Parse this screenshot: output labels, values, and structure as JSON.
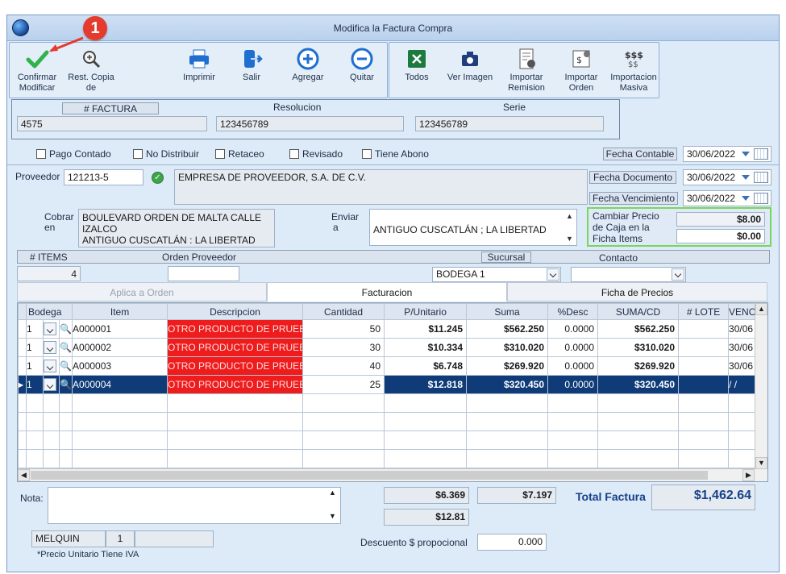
{
  "window": {
    "title": "Modifica la Factura Compra"
  },
  "annotation": {
    "badge": "1"
  },
  "toolbar": {
    "confirm": "Confirmar Modificar",
    "confirm_l1": "Confirmar",
    "confirm_l2": "Modificar",
    "rest_l1": "Rest. Copia",
    "rest_l2": "de",
    "print": "Imprimir",
    "exit": "Salir",
    "add": "Agregar",
    "remove": "Quitar",
    "all": "Todos",
    "view_image": "Ver Imagen",
    "import_remision_l1": "Importar",
    "import_remision_l2": "Remision",
    "import_orden_l1": "Importar",
    "import_orden_l2": "Orden",
    "import_masiva_l1": "Importacion",
    "import_masiva_l2": "Masiva"
  },
  "header": {
    "factura_label": "# FACTURA",
    "factura": "4575",
    "resolucion_label": "Resolucion",
    "resolucion": "123456789",
    "serie_label": "Serie",
    "serie": "123456789"
  },
  "checkboxes": {
    "pago_contado": "Pago Contado",
    "no_distribuir": "No Distribuir",
    "retaceo": "Retaceo",
    "revisado": "Revisado",
    "tiene_abono": "Tiene Abono"
  },
  "dates": {
    "contable_label": "Fecha Contable",
    "contable": "30/06/2022",
    "documento_label": "Fecha Documento",
    "documento": "30/06/2022",
    "vencimiento_label": "Fecha Vencimiento",
    "vencimiento": "30/06/2022"
  },
  "proveedor": {
    "label": "Proveedor",
    "code": "121213-5",
    "name": "EMPRESA DE PROVEEDOR, S.A. DE C.V."
  },
  "cobrar": {
    "label1": "Cobrar",
    "label2": "en",
    "line1": "BOULEVARD ORDEN DE MALTA CALLE",
    "line2": "IZALCO",
    "line3": "ANTIGUO CUSCATLÁN : LA LIBERTAD"
  },
  "enviar": {
    "label1": "Enviar",
    "label2": "a",
    "value": "ANTIGUO CUSCATLÁN ; LA LIBERTAD"
  },
  "precio_caja": {
    "l1": "Cambiar Precio",
    "l2": "de Caja en la",
    "l3": "Ficha Items",
    "v1": "$8.00",
    "v2": "$0.00"
  },
  "info_row": {
    "items_label": "# ITEMS",
    "items": "4",
    "orden_label": "Orden Proveedor",
    "orden": "",
    "sucursal_label": "Sucursal",
    "sucursal": "BODEGA 1",
    "contacto_label": "Contacto",
    "contacto": ""
  },
  "tabs": [
    {
      "label": "Aplica a Orden"
    },
    {
      "label": "Facturacion"
    },
    {
      "label": "Ficha de Precios"
    }
  ],
  "grid": {
    "columns": [
      "Bodega",
      "Item",
      "Descripcion",
      "Cantidad",
      "P/Unitario",
      "Suma",
      "%Desc",
      "SUMA/CD",
      "# LOTE",
      "VENC"
    ],
    "rows": [
      {
        "bodega": "1",
        "item": "A000001",
        "descripcion": "OTRO PRODUCTO DE PRUEBA",
        "cantidad": "50",
        "unitario": "$11.245",
        "suma": "$562.250",
        "desc": "0.0000",
        "sumacd": "$562.250",
        "lote": "",
        "venc": "30/06"
      },
      {
        "bodega": "1",
        "item": "A000002",
        "descripcion": "OTRO PRODUCTO DE PRUEBA",
        "cantidad": "30",
        "unitario": "$10.334",
        "suma": "$310.020",
        "desc": "0.0000",
        "sumacd": "$310.020",
        "lote": "",
        "venc": "30/06"
      },
      {
        "bodega": "1",
        "item": "A000003",
        "descripcion": "OTRO PRODUCTO DE PRUEBA",
        "cantidad": "40",
        "unitario": "$6.748",
        "suma": "$269.920",
        "desc": "0.0000",
        "sumacd": "$269.920",
        "lote": "",
        "venc": "30/06"
      },
      {
        "bodega": "1",
        "item": "A000004",
        "descripcion": "OTRO PRODUCTO DE PRUEBA",
        "cantidad": "25",
        "unitario": "$12.818",
        "suma": "$320.450",
        "desc": "0.0000",
        "sumacd": "$320.450",
        "lote": "",
        "venc": "/ /"
      }
    ]
  },
  "footer": {
    "nota_label": "Nota:",
    "nota": "",
    "t1": "$6.369",
    "t2": "$7.197",
    "t3": "$12.81",
    "total_label": "Total Factura",
    "total": "$1,462.64",
    "user": "MELQUIN",
    "user_num": "1",
    "user_extra": "",
    "descuento_label": "Descuento $ propocional",
    "descuento": "0.000",
    "iva_note": "*Precio Unitario Tiene IVA"
  },
  "colors": {
    "accent": "#0f3c78",
    "red": "#ee1c1c",
    "green_box": "#77d65c"
  }
}
